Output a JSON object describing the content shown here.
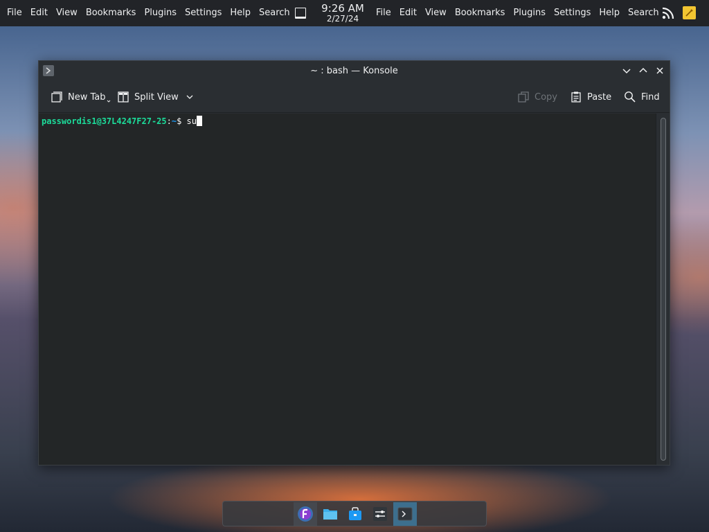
{
  "top_panel": {
    "menu_left": [
      "File",
      "Edit",
      "View",
      "Bookmarks",
      "Plugins",
      "Settings",
      "Help",
      "Search"
    ],
    "menu_right": [
      "File",
      "Edit",
      "View",
      "Bookmarks",
      "Plugins",
      "Settings",
      "Help",
      "Search"
    ],
    "clock": {
      "time": "9:26 AM",
      "date": "2/27/24"
    },
    "tray_icons": [
      "rss-feed-icon",
      "sticky-note-icon"
    ]
  },
  "window": {
    "title": "~ : bash — Konsole",
    "toolbar": {
      "new_tab": "New Tab",
      "split_view": "Split View",
      "copy": "Copy",
      "paste": "Paste",
      "find": "Find"
    },
    "terminal": {
      "user_host": "passwordis1@37L4247F27-25",
      "path": "~",
      "prompt_symbol": "$ ",
      "command": "su"
    }
  },
  "dock": {
    "items": [
      "fedora-launcher-icon",
      "file-manager-icon",
      "software-store-icon",
      "system-settings-icon",
      "konsole-icon"
    ]
  },
  "colors": {
    "prompt_user": "#1cdc9a",
    "prompt_path": "#1d99f3",
    "terminal_bg": "#232627",
    "window_bg": "#2a2e32"
  }
}
